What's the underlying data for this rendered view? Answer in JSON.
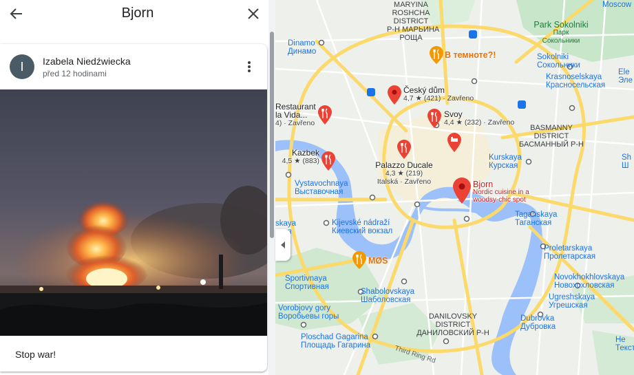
{
  "panel": {
    "title": "Bjorn",
    "back_icon": "arrow-back-icon",
    "close_icon": "close-icon"
  },
  "review": {
    "avatar_letter": "I",
    "avatar_color": "#4a5b65",
    "author": "Izabela Niedźwiecka",
    "time": "před 12 hodinami",
    "text": "Stop war!"
  },
  "map": {
    "districts": {
      "maryina_1": "MARYINA",
      "maryina_2": "ROSHCHA",
      "maryina_3": "DISTRICT",
      "maryina_4": "Р-Н МАРЬИНА",
      "maryina_5": "РОЩА",
      "basmanny_1": "BASMANNY",
      "basmanny_2": "DISTRICT",
      "basmanny_3": "БАСМАННЫЙ Р-Н",
      "danilovsky_1": "DANILOVSKY",
      "danilovsky_2": "DISTRICT",
      "danilovsky_3": "ДАНИЛОВСКИЙ Р-Н"
    },
    "metro": {
      "dinamo": "Dinamo",
      "dinamo_ru": "Динамо",
      "sokolniki": "Sokolniki",
      "sokolniki_ru": "Сокольники",
      "krasnoselskaya": "Krasnoselskaya",
      "krasnoselskaya_ru": "Красносельская",
      "kurskaya": "Kurskaya",
      "kurskaya_ru": "Курская",
      "vystavochnaya": "Vystavochnaya",
      "vystavochnaya_ru": "Выставочная",
      "kijevske": "Kijevské nádraží",
      "kijevske_ru": "Киевский вокзал",
      "taganskaya": "Taganskaya",
      "taganskaya_ru": "Таганская",
      "proletarskaya": "Proletarskaya",
      "proletarskaya_ru": "Пролетарская",
      "novokhokhlovskaya": "Novokhokhlovskaya",
      "novokhokhlovskaya_ru": "Новохохловская",
      "ugreshskaya": "Ugreshskaya",
      "ugreshskaya_ru": "Угрешская",
      "dubrovka": "Dubrovka",
      "dubrovka_ru": "Дубровка",
      "sportivnaya": "Sportivnaya",
      "sportivnaya_ru": "Спортивная",
      "shabolovskaya": "Shabolovskaya",
      "shabolovskaya_ru": "Шаболовская",
      "vorobjovy": "Vorobjovy gory",
      "vorobjovy_ru": "Воробьевы горы",
      "ploschad": "Ploschad Gagarina",
      "ploschad_ru": "Площадь Гагарина",
      "edge_skaya": "skaya",
      "edge_skaya_ru": "ская",
      "edge_sokolniki": "Сокольники",
      "edge_tekst": "Текст",
      "edge_he": "He",
      "edge_ele": "Ele",
      "edge_ele_ru": "Эле",
      "edge_sh": "Sh",
      "edge_sh_ru": "Ш"
    },
    "parks": {
      "park_sokolniki": "Park Sokolniki",
      "park_sokolniki_ru": "Парк",
      "park_sokolniki_ru2": "Сокольники"
    },
    "roads": {
      "third_ring": "Third Ring Rd"
    },
    "places": {
      "v_temnote": "В темноте?!",
      "mos": "MØS",
      "cesky_dum": "Český dům",
      "cesky_dum_rating": "4,7 ★ (421) · Zavřeno",
      "svoy": "Svoy",
      "svoy_rating": "4,4 ★ (232) · Zavřeno",
      "restaurant": "Restaurant",
      "restaurant_2": "la Vida...",
      "restaurant_rating": "4) · Zavřeno",
      "kazbek": "Kazbek",
      "kazbek_rating": "4,5 ★ (883)",
      "palazzo": "Palazzo Ducale",
      "palazzo_rating": "4,3 ★ (219)",
      "palazzo_sub": "Italská · Zavřeno",
      "bjorn": "Bjorn",
      "bjorn_sub_1": "Nordic cuisine in a",
      "bjorn_sub_2": "woodsy-chic spot",
      "edge_moscow": "Moscow"
    },
    "colors": {
      "land": "#eef0ec",
      "road_major": "#fbd96b",
      "road_minor": "#ffffff",
      "water": "#9cc0f9",
      "park": "#c8e6c9",
      "pin_red": "#ea4335",
      "metro_blue": "#1a73e8"
    }
  }
}
